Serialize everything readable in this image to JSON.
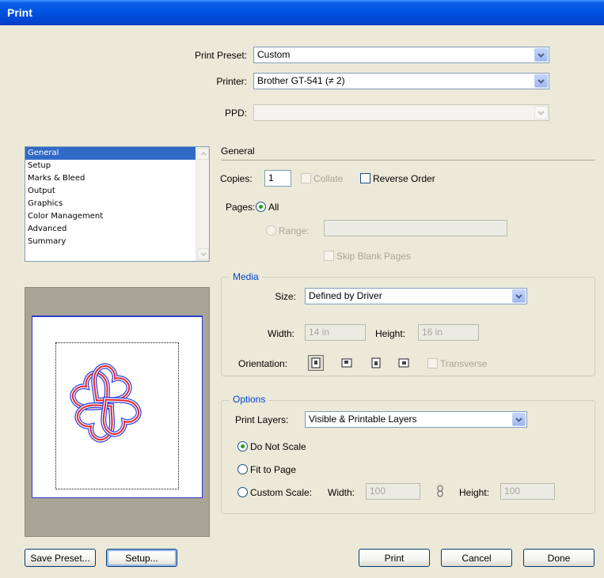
{
  "window": {
    "title": "Print"
  },
  "top": {
    "preset_label": "Print Preset:",
    "preset_value": "Custom",
    "printer_label": "Printer:",
    "printer_value": "Brother GT-541 (≠ 2)",
    "ppd_label": "PPD:",
    "ppd_value": ""
  },
  "sidebar": {
    "items": [
      {
        "label": "General",
        "selected": true
      },
      {
        "label": "Setup"
      },
      {
        "label": "Marks & Bleed"
      },
      {
        "label": "Output"
      },
      {
        "label": "Graphics"
      },
      {
        "label": "Color Management"
      },
      {
        "label": "Advanced"
      },
      {
        "label": "Summary"
      }
    ]
  },
  "general": {
    "heading": "General",
    "copies_label": "Copies:",
    "copies_value": "1",
    "collate_label": "Collate",
    "reverse_label": "Reverse Order",
    "pages_label": "Pages:",
    "all_label": "All",
    "range_label": "Range:",
    "range_value": "",
    "skip_blank_label": "Skip Blank Pages"
  },
  "media": {
    "legend": "Media",
    "size_label": "Size:",
    "size_value": "Defined by Driver",
    "width_label": "Width:",
    "width_value": "14 in",
    "height_label": "Height:",
    "height_value": "16 in",
    "orientation_label": "Orientation:",
    "transverse_label": "Transverse"
  },
  "options": {
    "legend": "Options",
    "layers_label": "Print Layers:",
    "layers_value": "Visible & Printable Layers",
    "do_not_scale_label": "Do Not Scale",
    "fit_label": "Fit to Page",
    "custom_label": "Custom Scale:",
    "width_label": "Width:",
    "width_value": "100",
    "height_label": "Height:",
    "height_value": "100"
  },
  "buttons": {
    "save_preset": "Save Preset...",
    "setup": "Setup...",
    "print": "Print",
    "cancel": "Cancel",
    "done": "Done"
  },
  "colors": {
    "accent": "#316ac5",
    "legend": "#0046d5",
    "title_bar": "#0055e5",
    "heart_red": "#e8252b",
    "heart_blue": "#2a3fe0"
  }
}
